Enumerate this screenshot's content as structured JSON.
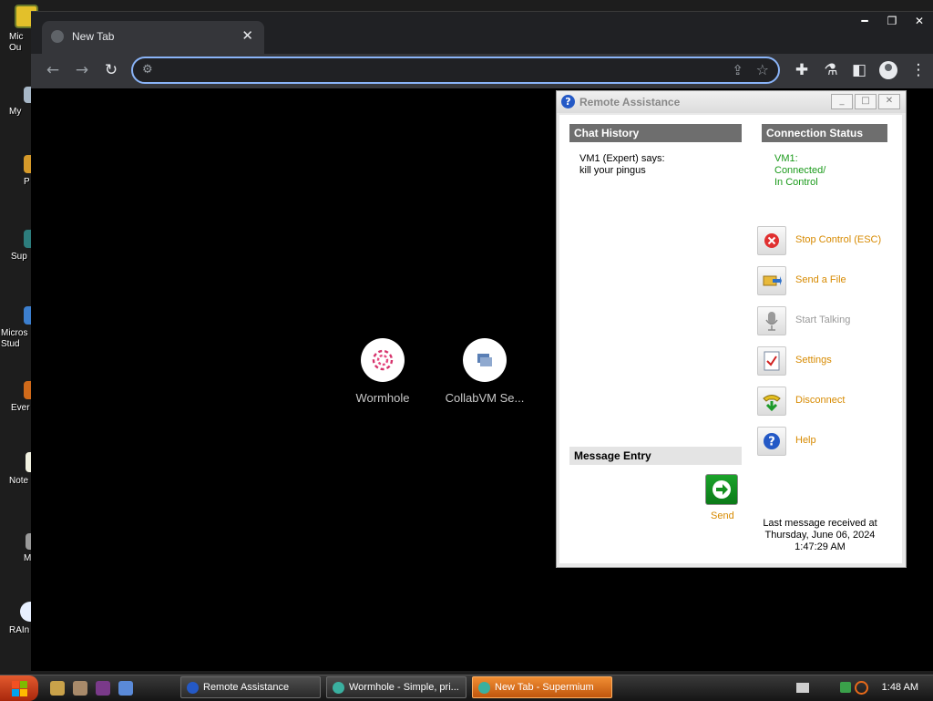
{
  "desktop": {
    "icons": [
      {
        "label": "Mic\nOu",
        "icon": "outlook-icon"
      },
      {
        "label": "My",
        "icon": "my-computer-icon"
      },
      {
        "label": "P",
        "icon": "program-icon"
      },
      {
        "label": "Sup",
        "icon": "supermium-icon"
      },
      {
        "label": "Micros\nStud",
        "icon": "visual-studio-icon"
      },
      {
        "label": "Ever",
        "icon": "everything-icon"
      },
      {
        "label": "Note",
        "icon": "notepad-icon"
      },
      {
        "label": "M",
        "icon": "m-icon"
      },
      {
        "label": "RAIn",
        "icon": "rain-icon"
      }
    ]
  },
  "browser": {
    "tab_title": "New Tab",
    "address_value": "",
    "shortcuts": [
      {
        "name": "Wormhole",
        "icon": "wormhole-icon"
      },
      {
        "name": "CollabVM Se...",
        "icon": "collabvm-icon"
      }
    ]
  },
  "remote_assistance": {
    "title": "Remote Assistance",
    "chat_history_label": "Chat History",
    "chat_line1": "VM1 (Expert) says:",
    "chat_line2": "kill your pingus",
    "connection_status_label": "Connection Status",
    "status_line1": "VM1:",
    "status_line2": "Connected/",
    "status_line3": "In Control",
    "actions": {
      "stop": "Stop Control (ESC)",
      "send_file": "Send a File",
      "start_talking": "Start Talking",
      "settings": "Settings",
      "disconnect": "Disconnect",
      "help": "Help"
    },
    "message_entry_label": "Message Entry",
    "send_label": "Send",
    "last_msg_line1": "Last message received at",
    "last_msg_line2": "Thursday, June 06, 2024",
    "last_msg_line3": "1:47:29 AM"
  },
  "taskbar": {
    "tasks": [
      {
        "label": "Remote Assistance"
      },
      {
        "label": "Wormhole - Simple, pri..."
      },
      {
        "label": "New Tab - Supermium"
      }
    ],
    "clock": "1:48 AM"
  },
  "colors": {
    "accent_orange": "#d78a00",
    "status_green": "#1a9a1a",
    "header_gray": "#6e6e6e",
    "omnibox_border": "#8ab4f8"
  }
}
